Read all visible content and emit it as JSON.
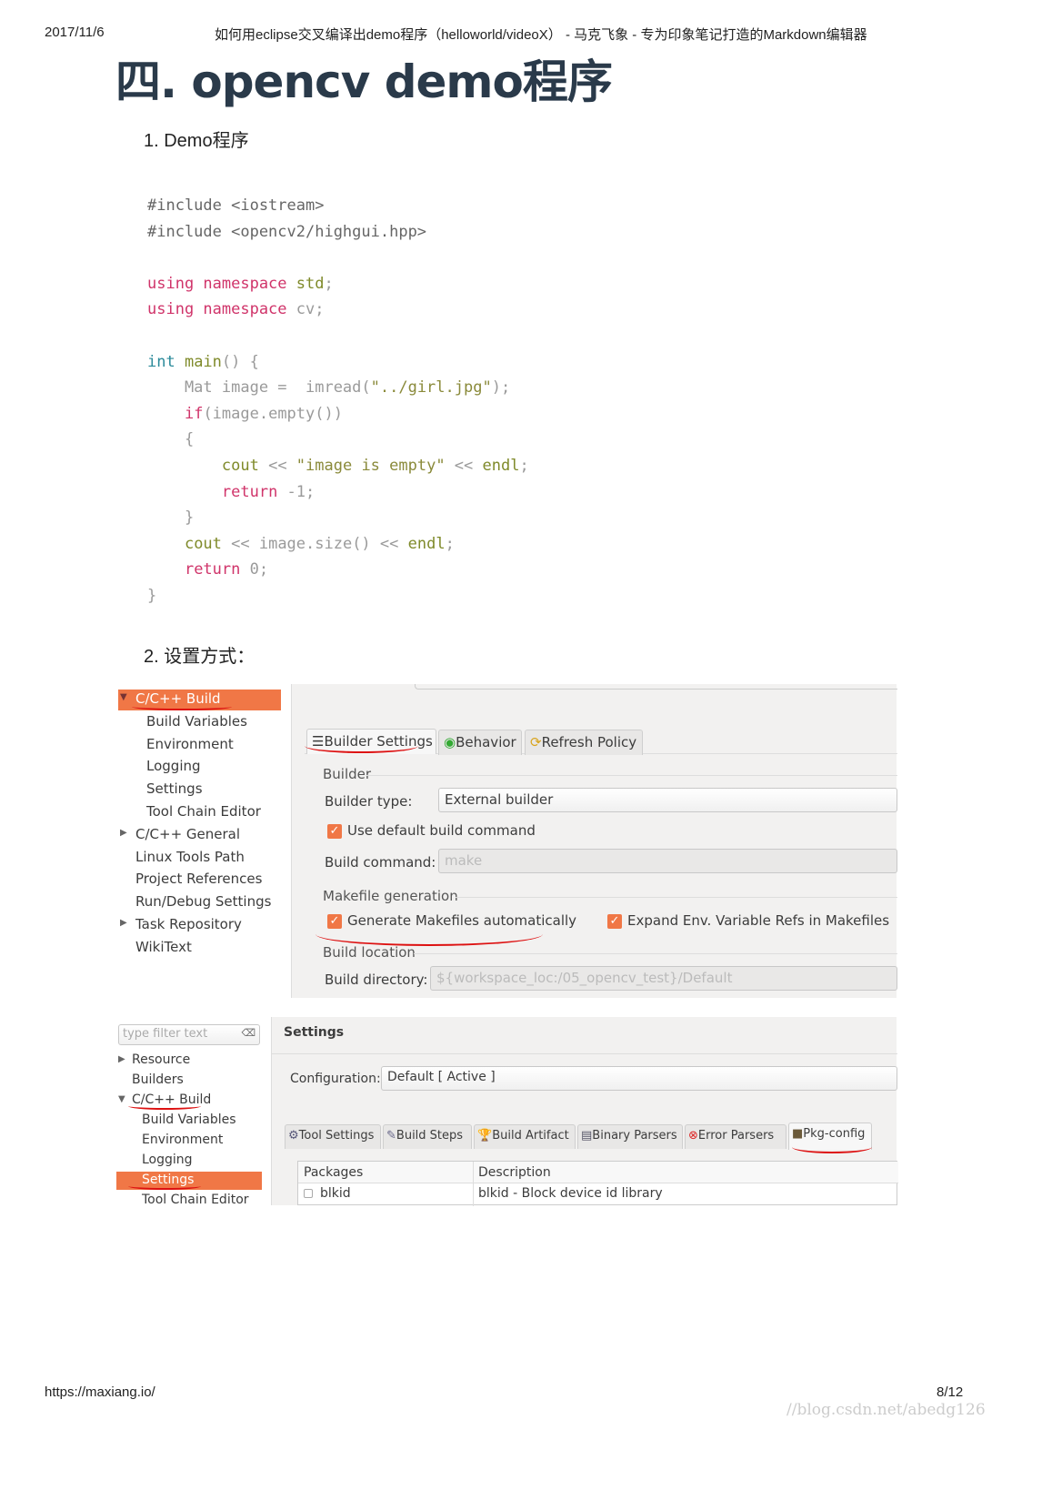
{
  "header": {
    "date": "2017/11/6",
    "title": "如何用eclipse交叉编译出demo程序（helloworld/videoX） - 马克飞象 - 专为印象笔记打造的Markdown编辑器"
  },
  "heading": "四. opencv demo程序",
  "section1": "1. Demo程序",
  "code": [
    [
      [
        "#include <iostream>",
        "pp"
      ]
    ],
    [
      [
        "#include <opencv2/highgui.hpp>",
        "pp"
      ]
    ],
    [],
    [
      [
        "using namespace ",
        "kw"
      ],
      [
        "std",
        "fn"
      ],
      [
        ";",
        "pl"
      ]
    ],
    [
      [
        "using namespace ",
        "kw"
      ],
      [
        "cv;",
        "pl"
      ]
    ],
    [],
    [
      [
        "int ",
        "ty"
      ],
      [
        "main",
        "fn"
      ],
      [
        "() {",
        "pl"
      ]
    ],
    [
      [
        "    Mat image =  imread(",
        "pl"
      ],
      [
        "\"../girl.jpg\"",
        "str"
      ],
      [
        ");",
        "pl"
      ]
    ],
    [
      [
        "    ",
        "pl"
      ],
      [
        "if",
        "kw"
      ],
      [
        "(image.empty())",
        "pl"
      ]
    ],
    [
      [
        "    {",
        "pl"
      ]
    ],
    [
      [
        "        ",
        "pl"
      ],
      [
        "cout",
        "fn"
      ],
      [
        " << ",
        "pl"
      ],
      [
        "\"image is empty\"",
        "str"
      ],
      [
        " << ",
        "pl"
      ],
      [
        "endl",
        "fn"
      ],
      [
        ";",
        "pl"
      ]
    ],
    [
      [
        "        ",
        "pl"
      ],
      [
        "return",
        "kw"
      ],
      [
        " -1;",
        "pl"
      ]
    ],
    [
      [
        "    }",
        "pl"
      ]
    ],
    [
      [
        "    ",
        "pl"
      ],
      [
        "cout",
        "fn"
      ],
      [
        " << image.size() << ",
        "pl"
      ],
      [
        "endl",
        "fn"
      ],
      [
        ";",
        "pl"
      ]
    ],
    [
      [
        "    ",
        "pl"
      ],
      [
        "return",
        "kw"
      ],
      [
        " 0;",
        "pl"
      ]
    ],
    [
      [
        "}",
        "pl"
      ]
    ]
  ],
  "section2": "2. 设置方式：",
  "shot1": {
    "tree": [
      {
        "label": "C/C++ Build",
        "selected": true,
        "expanded": true
      },
      {
        "label": "Build Variables"
      },
      {
        "label": "Environment"
      },
      {
        "label": "Logging"
      },
      {
        "label": "Settings"
      },
      {
        "label": "Tool Chain Editor"
      },
      {
        "label": "C/C++ General",
        "collapsed": true
      },
      {
        "label": "Linux Tools Path"
      },
      {
        "label": "Project References"
      },
      {
        "label": "Run/Debug Settings"
      },
      {
        "label": "Task Repository",
        "collapsed": true
      },
      {
        "label": "WikiText"
      }
    ],
    "tabs": [
      "Builder Settings",
      "Behavior",
      "Refresh Policy"
    ],
    "builder_group": "Builder",
    "builder_type_label": "Builder type:",
    "builder_type_value": "External builder",
    "use_default_label": "Use default build command",
    "use_default_checked": true,
    "build_command_label": "Build command:",
    "build_command_value": "make",
    "makefile_group": "Makefile generation",
    "generate_label": "Generate Makefiles automatically",
    "generate_checked": true,
    "expand_label": "Expand Env. Variable Refs in Makefiles",
    "expand_checked": true,
    "location_group": "Build location",
    "build_dir_label": "Build directory:",
    "build_dir_value": "${workspace_loc:/05_opencv_test}/Default"
  },
  "shot2": {
    "filter_placeholder": "type filter text",
    "tree": [
      {
        "label": "Resource",
        "collapsed": true
      },
      {
        "label": "Builders"
      },
      {
        "label": "C/C++ Build",
        "expanded": true
      },
      {
        "label": "Build Variables"
      },
      {
        "label": "Environment"
      },
      {
        "label": "Logging"
      },
      {
        "label": "Settings",
        "selected": true
      },
      {
        "label": "Tool Chain Editor"
      }
    ],
    "title": "Settings",
    "config_label": "Configuration:",
    "config_value": "Default  [ Active ]",
    "tabs": [
      "Tool Settings",
      "Build Steps",
      "Build Artifact",
      "Binary Parsers",
      "Error Parsers",
      "Pkg-config"
    ],
    "columns": [
      "Packages",
      "Description"
    ],
    "rows": [
      {
        "package": "blkid",
        "description": "blkid - Block device id library"
      }
    ]
  },
  "accent_color": "#f07746",
  "footer": {
    "url": "https://maxiang.io/",
    "page": "8/12",
    "watermark": "//blog.csdn.net/abedg126"
  }
}
